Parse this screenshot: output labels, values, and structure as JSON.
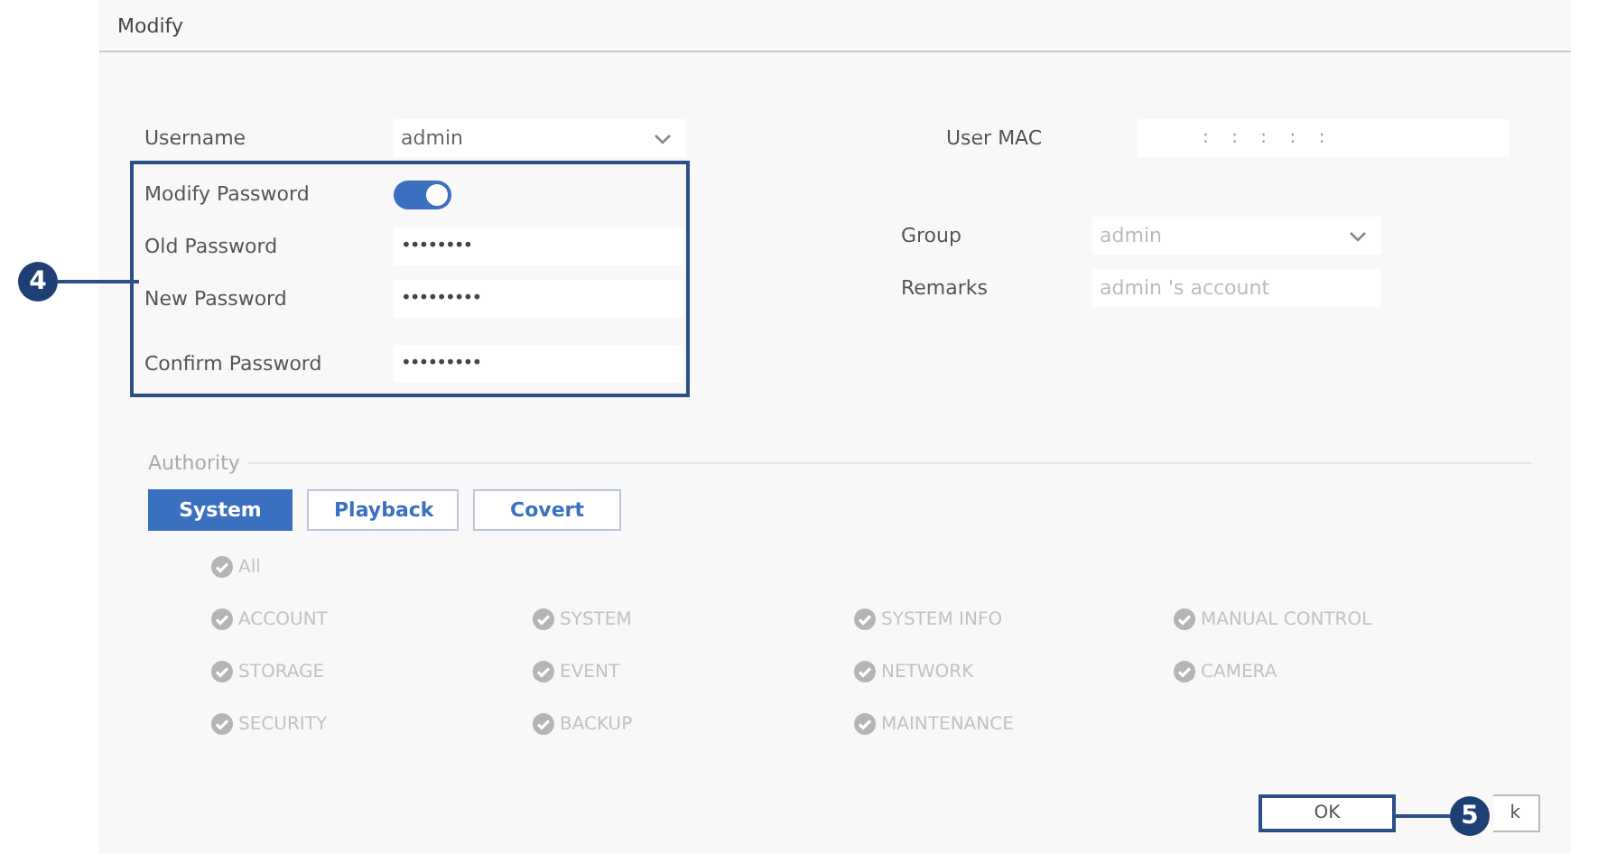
{
  "dialog": {
    "title": "Modify"
  },
  "left_fields": [
    {
      "label": "Username",
      "kind": "dropdown",
      "value": "admin"
    },
    {
      "label": "Modify Password",
      "kind": "toggle",
      "on": true
    },
    {
      "label": "Old Password",
      "kind": "password",
      "value": "••••••••"
    },
    {
      "label": "New Password",
      "kind": "password",
      "value": "•••••••••"
    },
    {
      "label": "Confirm Password",
      "kind": "password",
      "value": "•••••••••"
    }
  ],
  "right_fields": [
    {
      "label": "User MAC",
      "kind": "mac",
      "value": ":    :    :    :    :",
      "disabled": true
    },
    {
      "label": "Group",
      "kind": "dropdown",
      "value": "admin",
      "disabled": true
    },
    {
      "label": "Remarks",
      "kind": "text",
      "value": "admin 's account",
      "disabled": true
    }
  ],
  "authority": {
    "title": "Authority",
    "tabs": [
      {
        "label": "System",
        "selected": true
      },
      {
        "label": "Playback",
        "selected": false
      },
      {
        "label": "Covert",
        "selected": false
      }
    ],
    "all": {
      "label": "All",
      "checked": true
    },
    "permissions": [
      {
        "label": "ACCOUNT",
        "checked": true
      },
      {
        "label": "SYSTEM",
        "checked": true
      },
      {
        "label": "SYSTEM INFO",
        "checked": true
      },
      {
        "label": "MANUAL CONTROL",
        "checked": true
      },
      {
        "label": "STORAGE",
        "checked": true
      },
      {
        "label": "EVENT",
        "checked": true
      },
      {
        "label": "NETWORK",
        "checked": true
      },
      {
        "label": "CAMERA",
        "checked": true
      },
      {
        "label": "SECURITY",
        "checked": true
      },
      {
        "label": "BACKUP",
        "checked": true
      },
      {
        "label": "MAINTENANCE",
        "checked": true
      }
    ]
  },
  "buttons": [
    {
      "label": "OK"
    },
    {
      "label": "k"
    }
  ],
  "callouts": [
    {
      "label": "4"
    },
    {
      "label": "5"
    }
  ]
}
